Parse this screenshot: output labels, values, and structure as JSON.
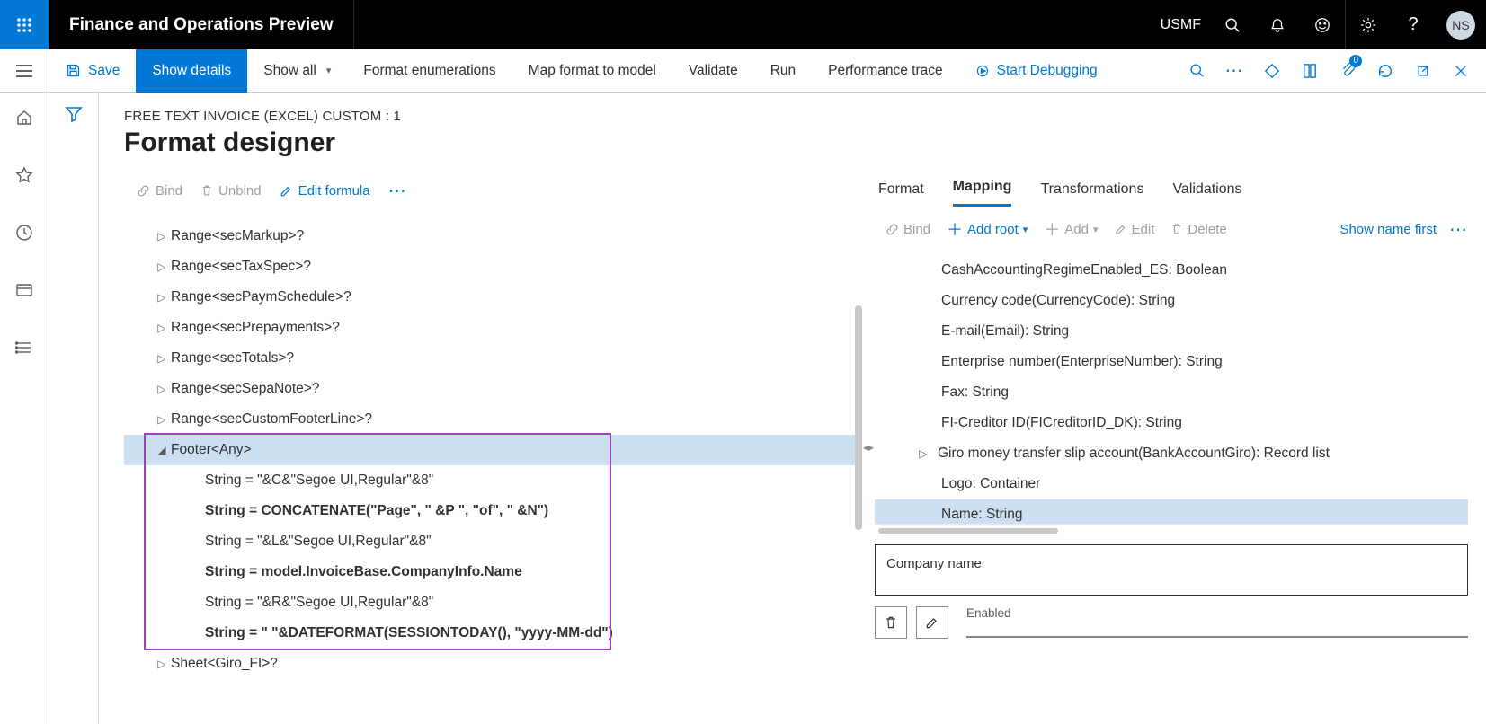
{
  "topbar": {
    "app_title": "Finance and Operations Preview",
    "entity": "USMF",
    "avatar": "NS"
  },
  "commandbar": {
    "save": "Save",
    "show_details": "Show details",
    "show_all": "Show all",
    "format_enum": "Format enumerations",
    "map_format": "Map format to model",
    "validate": "Validate",
    "run": "Run",
    "perf_trace": "Performance trace",
    "start_debug": "Start Debugging",
    "attach_badge": "0"
  },
  "header": {
    "breadcrumb": "FREE TEXT INVOICE (EXCEL) CUSTOM : 1",
    "title": "Format designer"
  },
  "left_toolbar": {
    "bind": "Bind",
    "unbind": "Unbind",
    "edit_formula": "Edit formula"
  },
  "tree": [
    {
      "indent": 1,
      "expand": "▷",
      "label": "Range<secMarkup>?"
    },
    {
      "indent": 1,
      "expand": "▷",
      "label": "Range<secTaxSpec>?"
    },
    {
      "indent": 1,
      "expand": "▷",
      "label": "Range<secPaymSchedule>?"
    },
    {
      "indent": 1,
      "expand": "▷",
      "label": "Range<secPrepayments>?"
    },
    {
      "indent": 1,
      "expand": "▷",
      "label": "Range<secTotals>?"
    },
    {
      "indent": 1,
      "expand": "▷",
      "label": "Range<secSepaNote>?"
    },
    {
      "indent": 1,
      "expand": "▷",
      "label": "Range<secCustomFooterLine>?"
    },
    {
      "indent": 1,
      "expand": "◢",
      "label": "Footer<Any>",
      "selected": true
    },
    {
      "indent": 2,
      "label": "String = \"&C&\"Segoe UI,Regular\"&8\""
    },
    {
      "indent": 2,
      "bold": true,
      "label": "String = CONCATENATE(\"Page\", \" &P \", \"of\", \" &N\")"
    },
    {
      "indent": 2,
      "label": "String = \"&L&\"Segoe UI,Regular\"&8\""
    },
    {
      "indent": 2,
      "bold": true,
      "label": "String = model.InvoiceBase.CompanyInfo.Name"
    },
    {
      "indent": 2,
      "label": "String = \"&R&\"Segoe UI,Regular\"&8\""
    },
    {
      "indent": 2,
      "bold": true,
      "label": "String = \" \"&DATEFORMAT(SESSIONTODAY(), \"yyyy-MM-dd\")"
    },
    {
      "indent": 1,
      "expand": "▷",
      "label": "Sheet<Giro_FI>?"
    }
  ],
  "tabs": {
    "format": "Format",
    "mapping": "Mapping",
    "transformations": "Transformations",
    "validations": "Validations"
  },
  "right_toolbar": {
    "bind": "Bind",
    "add_root": "Add root",
    "add": "Add",
    "edit": "Edit",
    "delete": "Delete",
    "show_name_first": "Show name first"
  },
  "model": [
    {
      "label": "CashAccountingRegimeEnabled_ES: Boolean"
    },
    {
      "label": "Currency code(CurrencyCode): String"
    },
    {
      "label": "E-mail(Email): String"
    },
    {
      "label": "Enterprise number(EnterpriseNumber): String"
    },
    {
      "label": "Fax: String"
    },
    {
      "label": "FI-Creditor ID(FICreditorID_DK): String"
    },
    {
      "label": "Giro money transfer slip account(BankAccountGiro): Record list",
      "has_expand": true
    },
    {
      "label": "Logo: Container"
    },
    {
      "label": "Name: String",
      "selected": true
    }
  ],
  "details": {
    "company_name": "Company name",
    "enabled_label": "Enabled"
  }
}
